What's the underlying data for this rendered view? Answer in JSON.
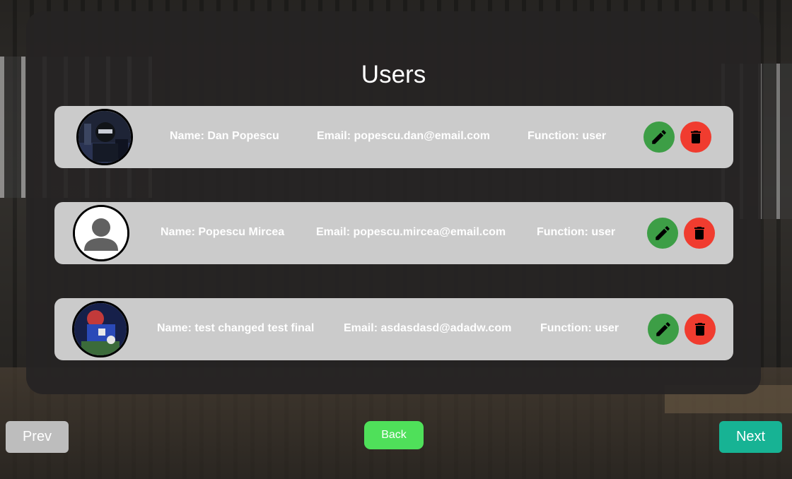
{
  "page": {
    "title": "Users"
  },
  "users": [
    {
      "name": "Name: Dan Popescu",
      "email": "Email: popescu.dan@email.com",
      "function": "Function: user",
      "avatar": "custom-photo"
    },
    {
      "name": "Name: Popescu Mircea",
      "email": "Email: popescu.mircea@email.com",
      "function": "Function: user",
      "avatar": "default-person-icon"
    },
    {
      "name": "Name: test changed test final",
      "email": "Email: asdasdasd@adadw.com",
      "function": "Function: user",
      "avatar": "custom-photo"
    }
  ],
  "actions": {
    "edit_icon": "pencil-icon",
    "delete_icon": "trash-icon"
  },
  "nav": {
    "prev_label": "Prev",
    "back_label": "Back",
    "next_label": "Next"
  },
  "colors": {
    "edit": "#3d9e46",
    "delete": "#f03c2f",
    "back": "#4fe05a",
    "next": "#17b394",
    "prev": "#bdbdbd",
    "card": "#cbcbcb"
  }
}
